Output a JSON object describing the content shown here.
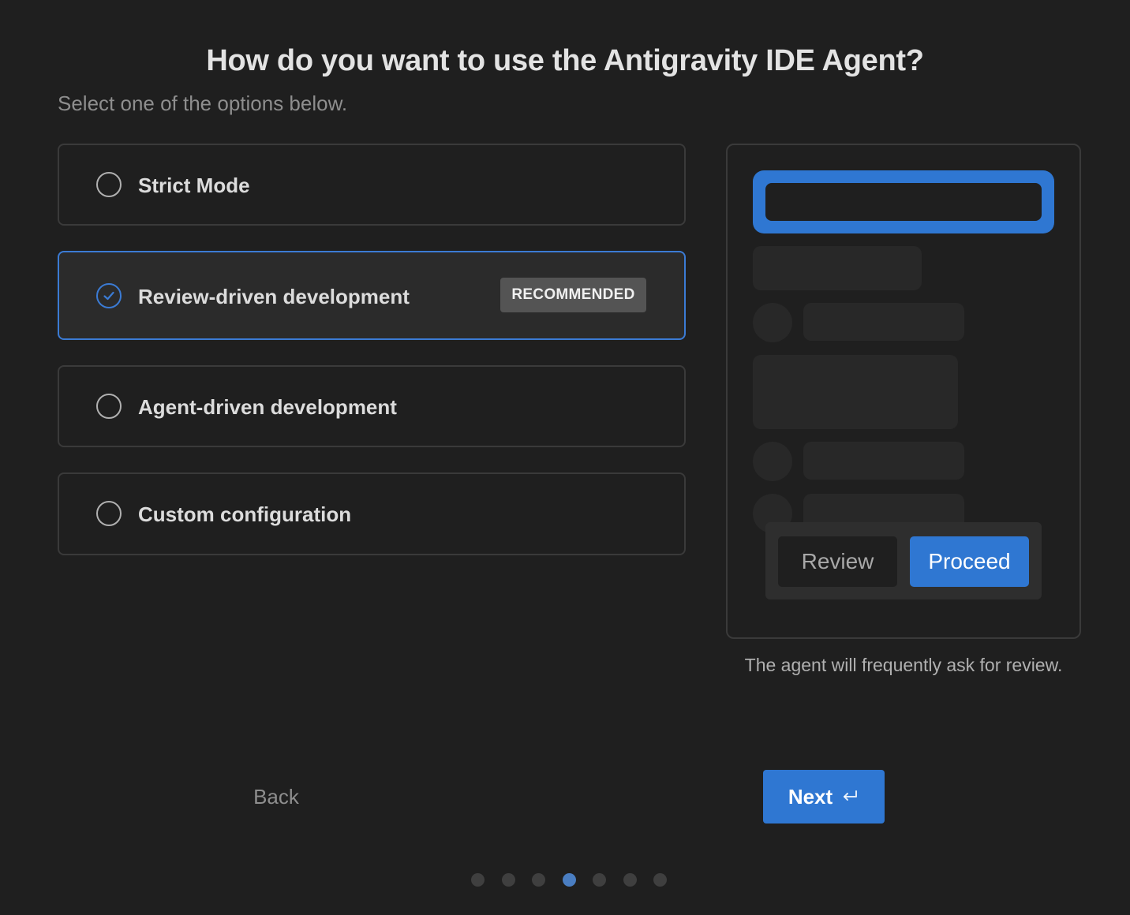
{
  "header": {
    "title": "How do you want to use the Antigravity IDE Agent?",
    "subtitle": "Select one of the options below."
  },
  "options": [
    {
      "label": "Strict Mode",
      "selected": false
    },
    {
      "label": "Review-driven development",
      "selected": true,
      "badge": "RECOMMENDED"
    },
    {
      "label": "Agent-driven development",
      "selected": false
    },
    {
      "label": "Custom configuration",
      "selected": false
    }
  ],
  "preview": {
    "review_label": "Review",
    "proceed_label": "Proceed",
    "caption": "The agent will frequently ask for review."
  },
  "footer": {
    "back_label": "Back",
    "next_label": "Next",
    "next_icon": "enter-icon"
  },
  "pagination": {
    "total": 7,
    "current": 4
  },
  "colors": {
    "accent": "#2f77d2",
    "background": "#1f1f1f",
    "selected_border": "#3b7bd4"
  }
}
